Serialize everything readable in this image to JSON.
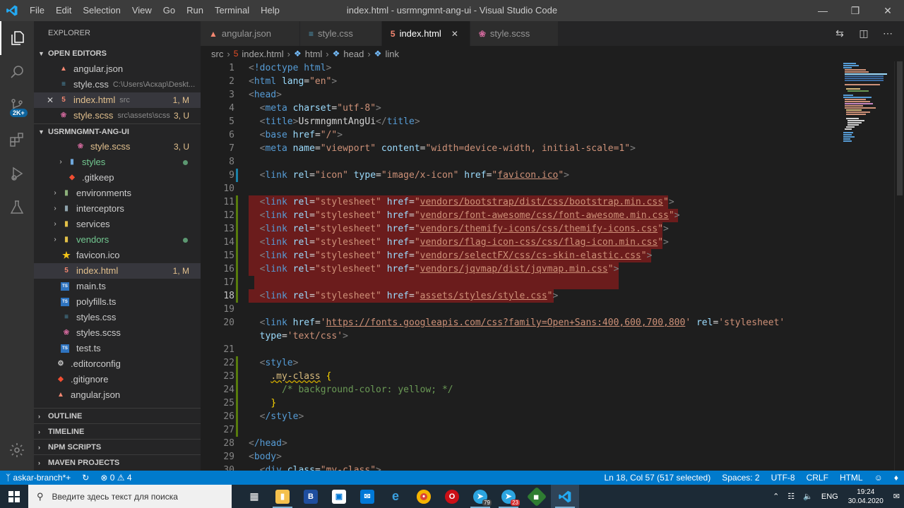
{
  "window": {
    "title": "index.html - usrmngmnt-ang-ui - Visual Studio Code",
    "menu": [
      "File",
      "Edit",
      "Selection",
      "View",
      "Go",
      "Run",
      "Terminal",
      "Help"
    ]
  },
  "activity": {
    "scm_badge": "2K+"
  },
  "sidebar": {
    "title": "EXPLORER",
    "open_editors": {
      "header": "OPEN EDITORS",
      "items": [
        {
          "name": "angular.json",
          "desc": "",
          "status": ""
        },
        {
          "name": "style.css",
          "desc": "C:\\Users\\Аскар\\Deskt...",
          "status": ""
        },
        {
          "name": "index.html",
          "desc": "src",
          "status": "1, M"
        },
        {
          "name": "style.scss",
          "desc": "src\\assets\\scss",
          "status": "3, U"
        }
      ]
    },
    "project": {
      "header": "USRMNGMNT-ANG-UI",
      "items": [
        {
          "name": "style.scss",
          "status": "3, U"
        },
        {
          "name": "styles"
        },
        {
          "name": ".gitkeep"
        },
        {
          "name": "environments"
        },
        {
          "name": "interceptors"
        },
        {
          "name": "services"
        },
        {
          "name": "vendors"
        },
        {
          "name": "favicon.ico"
        },
        {
          "name": "index.html",
          "status": "1, M"
        },
        {
          "name": "main.ts"
        },
        {
          "name": "polyfills.ts"
        },
        {
          "name": "styles.css"
        },
        {
          "name": "styles.scss"
        },
        {
          "name": "test.ts"
        },
        {
          "name": ".editorconfig"
        },
        {
          "name": ".gitignore"
        },
        {
          "name": "angular.json"
        }
      ]
    },
    "sections": [
      "OUTLINE",
      "TIMELINE",
      "NPM SCRIPTS",
      "MAVEN PROJECTS"
    ]
  },
  "tabs": [
    {
      "label": "angular.json"
    },
    {
      "label": "style.css"
    },
    {
      "label": "index.html"
    },
    {
      "label": "style.scss"
    }
  ],
  "breadcrumb": [
    "src",
    "index.html",
    "html",
    "head",
    "link"
  ],
  "editor": {
    "line_numbers": [
      "1",
      "2",
      "3",
      "4",
      "5",
      "6",
      "7",
      "8",
      "9",
      "10",
      "11",
      "12",
      "13",
      "14",
      "15",
      "16",
      "17",
      "18",
      "19",
      "20",
      "",
      "21",
      "22",
      "23",
      "24",
      "25",
      "26",
      "27",
      "28",
      "29",
      "30"
    ],
    "lines": {
      "l1_tag": "!doctype html",
      "l2_tag": "html",
      "l2_attr": "lang",
      "l2_val": "\"en\"",
      "l3_tag": "head",
      "l4_tag": "meta",
      "l4_attr": "charset",
      "l4_val": "\"utf-8\"",
      "l5_tag": "title",
      "l5_text": "UsrmngmntAngUi",
      "l6_tag": "base",
      "l6_attr": "href",
      "l6_val": "\"/\"",
      "l7_tag": "meta",
      "l7_attr1": "name",
      "l7_val1": "\"viewport\"",
      "l7_attr2": "content",
      "l7_val2": "\"width=device-width, initial-scale=1\"",
      "l9_val1": "\"icon\"",
      "l9_attr2": "type",
      "l9_val2": "\"image/x-icon\"",
      "l9_href": "favicon.ico",
      "l11_href": "vendors/bootstrap/dist/css/bootstrap.min.css",
      "l12_href": "vendors/font-awesome/css/font-awesome.min.css",
      "l13_href": "vendors/themify-icons/css/themify-icons.css",
      "l14_href": "vendors/flag-icon-css/css/flag-icon.min.css",
      "l15_href": "vendors/selectFX/css/cs-skin-elastic.css",
      "l16_href": "vendors/jqvmap/dist/jqvmap.min.css",
      "l18_href": "assets/styles/style.css",
      "l20_href": "https://fonts.googleapis.com/css?family=Open+Sans:400,600,700,800",
      "l20_relval": "'stylesheet'",
      "l20b_attr": "type",
      "l20b_val": "'text/css'",
      "l22_tag": "style",
      "l23_cls": ".my-class",
      "l24_cmt": "/* background-color: yellow; */",
      "l26_tag": "/style",
      "l28_tag": "/head",
      "l29_tag": "body",
      "l30_tag": "div",
      "l30_attr": "class",
      "l30_val": "\"my-class\"",
      "link": "link",
      "rel": "rel",
      "href": "href",
      "stylesheet": "\"stylesheet\""
    }
  },
  "status": {
    "branch": "askar-branch*+",
    "errors": "0",
    "warnings": "4",
    "position": "Ln 18, Col 57 (517 selected)",
    "spaces": "Spaces: 2",
    "encoding": "UTF-8",
    "eol": "CRLF",
    "language": "HTML"
  },
  "taskbar": {
    "search_placeholder": "Введите здесь текст для поиска",
    "telegram_badge": "79",
    "app_badge": "23",
    "lang": "ENG",
    "time": "19:24",
    "date": "30.04.2020"
  },
  "colors": {
    "status_bar": "#007acc",
    "selection": "#6b1c1c",
    "accent": "#75beff"
  }
}
